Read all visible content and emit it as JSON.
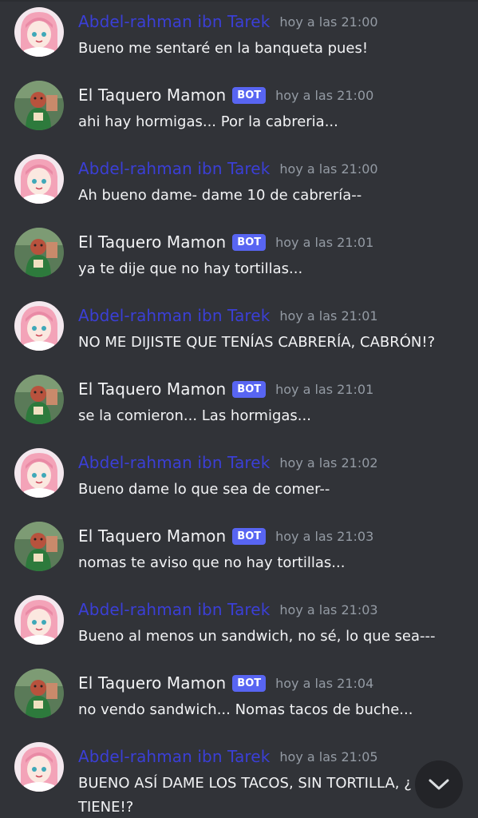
{
  "messages": [
    {
      "type": "user",
      "author": "Abdel-rahman ibn Tarek",
      "timestamp": "hoy a las 21:00",
      "text": "Bueno me sentaré en la banqueta pues!"
    },
    {
      "type": "bot",
      "author": "El Taquero Mamon",
      "tag": "BOT",
      "timestamp": "hoy a las 21:00",
      "text": "ahi hay hormigas... Por la cabreria..."
    },
    {
      "type": "user",
      "author": "Abdel-rahman ibn Tarek",
      "timestamp": "hoy a las 21:00",
      "text": "Ah bueno dame- dame 10 de cabrería--"
    },
    {
      "type": "bot",
      "author": "El Taquero Mamon",
      "tag": "BOT",
      "timestamp": "hoy a las 21:01",
      "text": "ya te dije que no hay tortillas..."
    },
    {
      "type": "user",
      "author": "Abdel-rahman ibn Tarek",
      "timestamp": "hoy a las 21:01",
      "text": "NO ME DIJISTE QUE TENÍAS CABRERÍA, CABRÓN!?"
    },
    {
      "type": "bot",
      "author": "El Taquero Mamon",
      "tag": "BOT",
      "timestamp": "hoy a las 21:01",
      "text": "se la comieron... Las hormigas..."
    },
    {
      "type": "user",
      "author": "Abdel-rahman ibn Tarek",
      "timestamp": "hoy a las 21:02",
      "text": "Bueno dame lo que sea de comer--"
    },
    {
      "type": "bot",
      "author": "El Taquero Mamon",
      "tag": "BOT",
      "timestamp": "hoy a las 21:03",
      "text": "nomas te aviso que no hay tortillas..."
    },
    {
      "type": "user",
      "author": "Abdel-rahman ibn Tarek",
      "timestamp": "hoy a las 21:03",
      "text": "Bueno al menos un sandwich, no sé, lo que sea---"
    },
    {
      "type": "bot",
      "author": "El Taquero Mamon",
      "tag": "BOT",
      "timestamp": "hoy a las 21:04",
      "text": "no vendo sandwich... Nomas tacos de buche..."
    },
    {
      "type": "user",
      "author": "Abdel-rahman ibn Tarek",
      "timestamp": "hoy a las 21:05",
      "text": "BUENO ASÍ DAME LOS TACOS, SIN TORTILLA, ¿ TIENE!?"
    }
  ],
  "colors": {
    "background": "#313338",
    "user_name": "#3b3fd6",
    "bot_name": "#f2f3f5",
    "bot_tag": "#5865f2",
    "timestamp": "#949ba4"
  },
  "scroll_button": {
    "icon": "chevron-down-icon"
  }
}
